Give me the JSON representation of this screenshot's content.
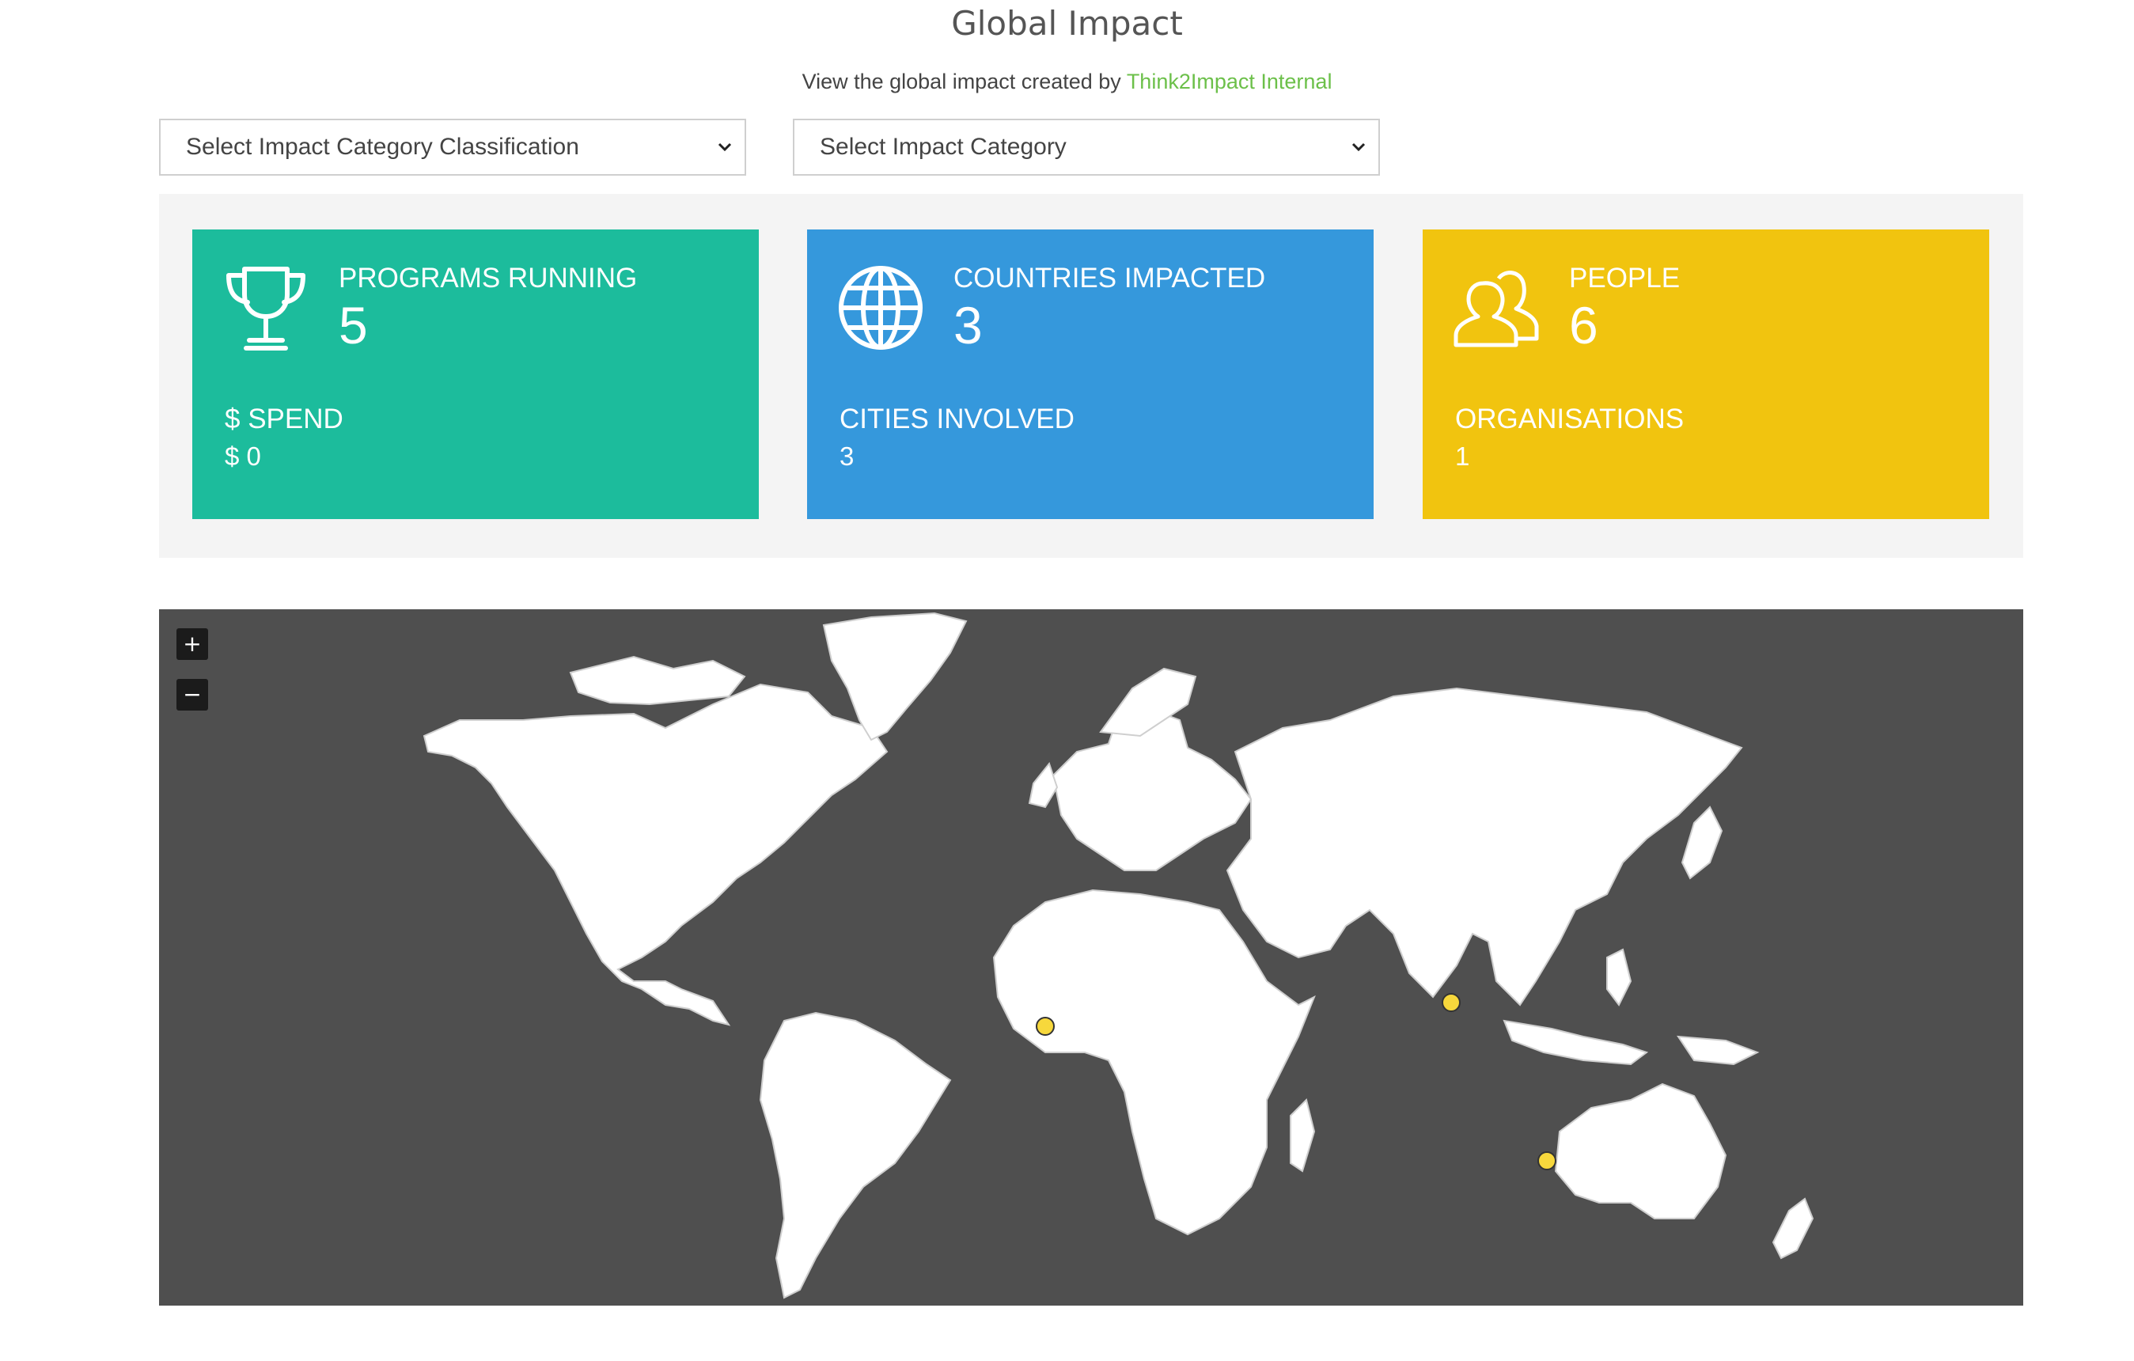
{
  "header": {
    "title": "Global Impact",
    "subtitle_prefix": "View the global impact created by ",
    "org_name": "Think2Impact Internal"
  },
  "filters": {
    "classification_select": "Select Impact Category Classification",
    "category_select": "Select Impact Category"
  },
  "cards": [
    {
      "color": "#1cbc9c",
      "icon": "trophy-icon",
      "top_label": "PROGRAMS RUNNING",
      "top_value": "5",
      "bottom_label": "$ SPEND",
      "bottom_value": "$ 0"
    },
    {
      "color": "#3598dc",
      "icon": "globe-icon",
      "top_label": "COUNTRIES IMPACTED",
      "top_value": "3",
      "bottom_label": "CITIES INVOLVED",
      "bottom_value": "3"
    },
    {
      "color": "#f1c40f",
      "icon": "people-icon",
      "top_label": "PEOPLE",
      "top_value": "6",
      "bottom_label": "ORGANISATIONS",
      "bottom_value": "1"
    }
  ],
  "map": {
    "background": "#4f4f4f",
    "land_color": "#ffffff",
    "marker_color": "#f7d83c",
    "zoom_in_label": "+",
    "zoom_out_label": "−",
    "markers": [
      {
        "region": "West Africa"
      },
      {
        "region": "Southeast Asia"
      },
      {
        "region": "Australia"
      }
    ]
  }
}
